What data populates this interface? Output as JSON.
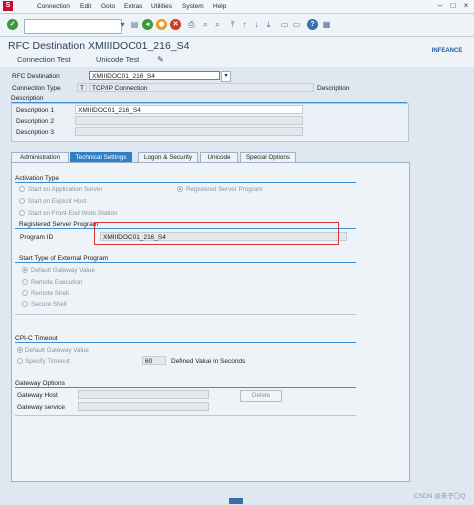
{
  "menu": {
    "items": [
      "Connection",
      "Edit",
      "Goto",
      "Extras",
      "Utilities",
      "System",
      "Help"
    ]
  },
  "toolbar": {
    "command_value": ""
  },
  "header": {
    "title": "RFC Destination XMIIIDOC01_216_S4",
    "logo": "INFEANCE"
  },
  "app_toolbar": {
    "connection_test": "Connection Test",
    "unicode_test": "Unicode Test"
  },
  "form": {
    "rfc_destination_label": "RFC Destination",
    "rfc_destination_value": "XMIIIDOC01_216_S4",
    "connection_type_label": "Connection Type",
    "connection_type_code": "T",
    "connection_type_text": "TCP/IP Connection",
    "description_label": "Description",
    "description_group": "Description",
    "desc1_label": "Description 1",
    "desc1_value": "XMIIIDOC01_216_S4",
    "desc2_label": "Description 2",
    "desc2_value": "",
    "desc3_label": "Description 3",
    "desc3_value": ""
  },
  "tabs": [
    {
      "label": "Administration"
    },
    {
      "label": "Technical Settings"
    },
    {
      "label": "Logon & Security"
    },
    {
      "label": "Unicode"
    },
    {
      "label": "Special Options"
    }
  ],
  "activation": {
    "group": "Activation Type",
    "opt1": "Start on Application Server",
    "opt2": "Registered Server Program",
    "opt3": "Start on Explicit Host",
    "opt4": "Start on Front-End Work Station"
  },
  "registered": {
    "group": "Registered Server Program",
    "program_id_label": "Program ID",
    "program_id_value": "XMIIIDOC01_216_S4"
  },
  "start_type": {
    "group": "Start Type of External Program",
    "opt1": "Default Gateway Value",
    "opt2": "Remote Execution",
    "opt3": "Remote Shell",
    "opt4": "Secure Shell"
  },
  "cpic": {
    "group": "CPI-C Timeout",
    "opt1": "Default Gateway Value",
    "opt2": "Specify Timeout",
    "timeout_value": "60",
    "timeout_suffix": "Defined Value in Seconds"
  },
  "gateway": {
    "group": "Gateway Options",
    "host_label": "Gateway Host",
    "host_value": "",
    "service_label": "Gateway service",
    "service_value": "",
    "delete_label": "Delete"
  },
  "watermark": "CSDN @朱子〇Q",
  "colors": {
    "accent": "#2f7fc8",
    "highlight": "#d23a3a"
  }
}
